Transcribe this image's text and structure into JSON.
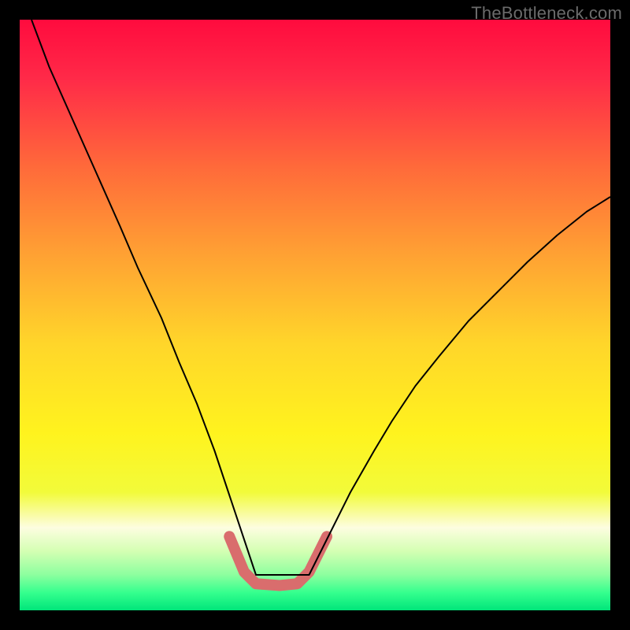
{
  "watermark": "TheBottleneck.com",
  "chart_data": {
    "type": "line",
    "title": "",
    "xlabel": "",
    "ylabel": "",
    "xlim": [
      0,
      100
    ],
    "ylim": [
      0,
      100
    ],
    "background_gradient_stops": [
      {
        "offset": 0.0,
        "color": "#ff0b3e"
      },
      {
        "offset": 0.1,
        "color": "#ff2a48"
      },
      {
        "offset": 0.25,
        "color": "#ff6a3a"
      },
      {
        "offset": 0.4,
        "color": "#ffa233"
      },
      {
        "offset": 0.55,
        "color": "#ffd62a"
      },
      {
        "offset": 0.7,
        "color": "#fff31e"
      },
      {
        "offset": 0.8,
        "color": "#f2fb3a"
      },
      {
        "offset": 0.86,
        "color": "#fdfde0"
      },
      {
        "offset": 0.9,
        "color": "#d4ffb3"
      },
      {
        "offset": 0.94,
        "color": "#8cff9f"
      },
      {
        "offset": 0.97,
        "color": "#35ff8e"
      },
      {
        "offset": 1.0,
        "color": "#00e57a"
      }
    ],
    "series": [
      {
        "name": "bottleneck-curve",
        "stroke": "#000000",
        "stroke_width": 2,
        "x": [
          2,
          5,
          9,
          13,
          17,
          20,
          24,
          27,
          30,
          33,
          35.5,
          38,
          40,
          44,
          47,
          49,
          52,
          56,
          60,
          63,
          67,
          71,
          76,
          81,
          86,
          91,
          96,
          100
        ],
        "y": [
          100,
          92,
          83,
          74,
          65,
          58,
          49.5,
          42,
          35,
          27,
          19.5,
          12,
          6,
          6,
          6,
          6,
          12,
          20,
          27,
          32,
          38,
          43,
          49,
          54,
          59,
          63.5,
          67.5,
          70
        ]
      },
      {
        "name": "trough-highlight",
        "stroke": "#d96d6d",
        "stroke_width": 14,
        "linecap": "round",
        "x": [
          35.5,
          38,
          40,
          44,
          47,
          49,
          52
        ],
        "y": [
          12.5,
          6.5,
          4.5,
          4.2,
          4.5,
          6.5,
          12.5
        ]
      }
    ]
  }
}
